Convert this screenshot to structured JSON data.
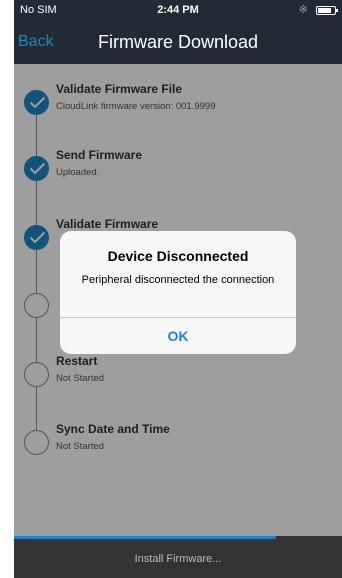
{
  "status_bar": {
    "carrier": "No SIM",
    "time": "2:44 PM",
    "bluetooth_icon": "bluetooth-icon",
    "battery_icon": "battery-icon"
  },
  "nav": {
    "back_label": "Back",
    "title": "Firmware Download"
  },
  "steps": [
    {
      "title": "Validate Firmware File",
      "subtitle": "CloudLink firmware version: 001.9999",
      "status": "done"
    },
    {
      "title": "Send Firmware",
      "subtitle": "Uploaded.",
      "status": "done"
    },
    {
      "title": "Validate Firmware",
      "subtitle": "",
      "status": "done"
    },
    {
      "title": "",
      "subtitle": "",
      "status": "pending"
    },
    {
      "title": "Restart",
      "subtitle": "Not Started",
      "status": "pending"
    },
    {
      "title": "Sync Date and Time",
      "subtitle": "Not Started",
      "status": "pending"
    }
  ],
  "dialog": {
    "title": "Device Disconnected",
    "message": "Peripheral disconnected the connection",
    "ok_label": "OK"
  },
  "footer": {
    "label": "Install Firmware...",
    "progress": 0.8
  },
  "colors": {
    "accent": "#1b86c7",
    "bar_bg": "#222b33",
    "footer_bg": "#333333",
    "dialog_button": "#1b7fe8"
  }
}
